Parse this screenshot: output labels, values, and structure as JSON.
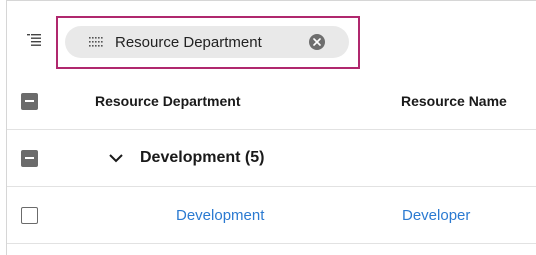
{
  "group_panel": {
    "chip": {
      "label": "Resource Department",
      "grip_icon": "grip-dots-icon",
      "remove_icon": "close-circle-icon"
    },
    "tree_toggle_icon": "tree-list-icon",
    "highlight_color": "#b0286e"
  },
  "grid": {
    "columns": [
      {
        "label": "Resource Department"
      },
      {
        "label": "Resource Name"
      }
    ],
    "groups": [
      {
        "caption": "Development (5)",
        "expanded": true,
        "rows": [
          {
            "department": "Development",
            "name": "Developer"
          }
        ]
      }
    ]
  },
  "colors": {
    "link_text": "#2b7ad1",
    "chip_background": "#e9e9e9",
    "checkbox": "#6b6b6b"
  }
}
